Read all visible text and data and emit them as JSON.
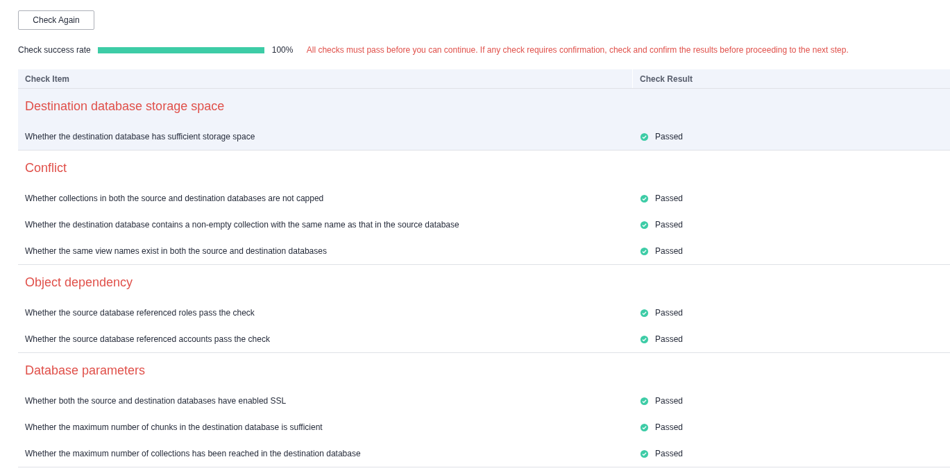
{
  "check_again_button": "Check Again",
  "success_rate": {
    "label": "Check success rate",
    "level": 1,
    "reading": "100%"
  },
  "notice": "All checks must pass before you can continue. If any check requires confirmation, check and confirm the results before proceeding to the next step.",
  "table": {
    "columns": [
      "Check Item",
      "Check Result"
    ],
    "groups": [
      {
        "title": "Destination database storage space",
        "highlighted": true,
        "items": [
          {
            "name": "Whether the destination database has sufficient storage space",
            "kind": "passed",
            "result": "Passed"
          }
        ]
      },
      {
        "title": "Conflict",
        "highlighted": false,
        "items": [
          {
            "name": "Whether collections in both the source and destination databases are not capped",
            "kind": "passed",
            "result": "Passed"
          },
          {
            "name": "Whether the destination database contains a non-empty collection with the same name as that in the source database",
            "kind": "passed",
            "result": "Passed"
          },
          {
            "name": "Whether the same view names exist in both the source and destination databases",
            "kind": "passed",
            "result": "Passed"
          }
        ]
      },
      {
        "title": "Object dependency",
        "highlighted": false,
        "items": [
          {
            "name": "Whether the source database referenced roles pass the check",
            "kind": "passed",
            "result": "Passed"
          },
          {
            "name": "Whether the source database referenced accounts pass the check",
            "kind": "passed",
            "result": "Passed"
          }
        ]
      },
      {
        "title": "Database parameters",
        "highlighted": false,
        "items": [
          {
            "name": "Whether both the source and destination databases have enabled SSL",
            "kind": "passed",
            "result": "Passed"
          },
          {
            "name": "Whether the maximum number of chunks in the destination database is sufficient",
            "kind": "passed",
            "result": "Passed"
          },
          {
            "name": "Whether the maximum number of collections has been reached in the destination database",
            "kind": "passed",
            "result": "Passed"
          }
        ]
      }
    ]
  }
}
